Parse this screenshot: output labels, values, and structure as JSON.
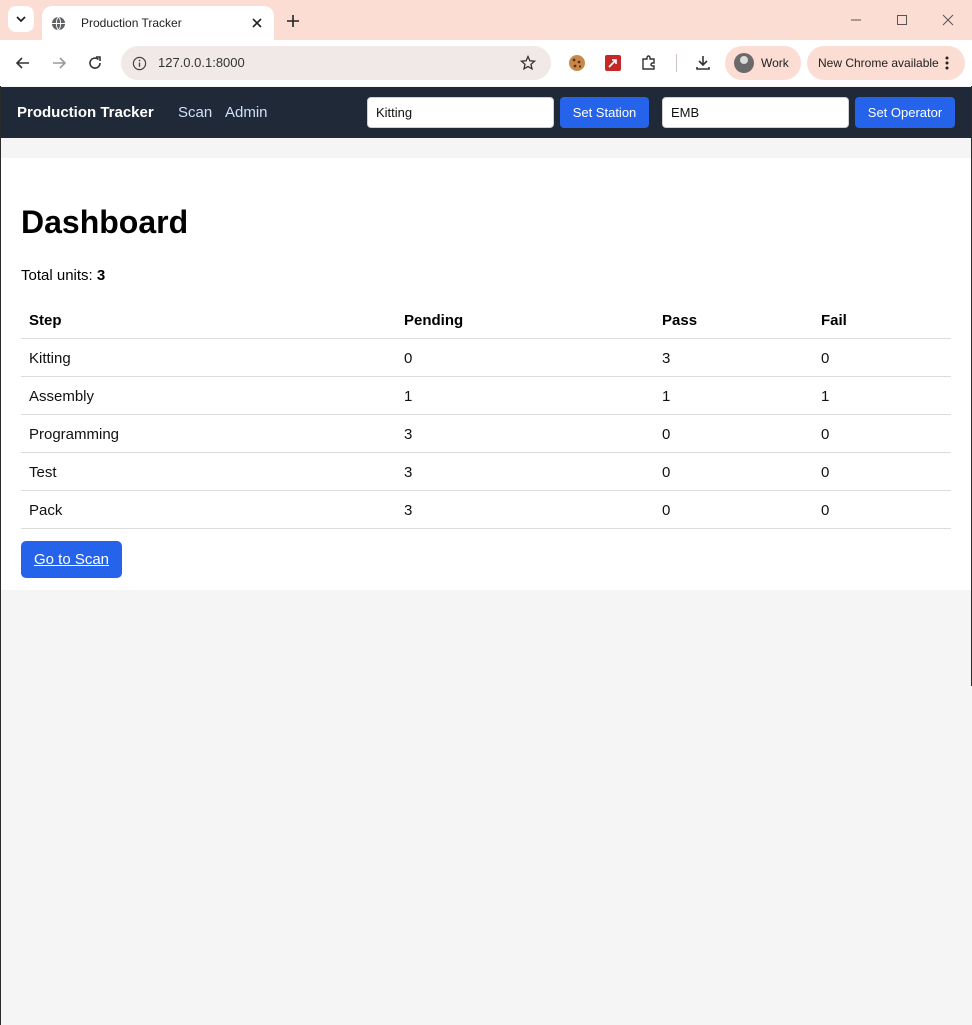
{
  "browser": {
    "tab_title": "Production Tracker",
    "url": "127.0.0.1:8000",
    "profile_name": "Work",
    "update_label": "New Chrome available"
  },
  "nav": {
    "brand": "Production Tracker",
    "links": [
      "Scan",
      "Admin"
    ],
    "station_value": "Kitting",
    "set_station_label": "Set Station",
    "operator_value": "EMB",
    "set_operator_label": "Set Operator"
  },
  "page": {
    "title": "Dashboard",
    "total_label": "Total units:",
    "total_value": "3",
    "cta_label": "Go to Scan"
  },
  "table": {
    "headers": [
      "Step",
      "Pending",
      "Pass",
      "Fail"
    ],
    "rows": [
      [
        "Kitting",
        "0",
        "3",
        "0"
      ],
      [
        "Assembly",
        "1",
        "1",
        "1"
      ],
      [
        "Programming",
        "3",
        "0",
        "0"
      ],
      [
        "Test",
        "3",
        "0",
        "0"
      ],
      [
        "Pack",
        "3",
        "0",
        "0"
      ]
    ]
  },
  "colors": {
    "navbar": "#1f2937",
    "accent": "#2563eb",
    "chrome_frame": "#fbddd3"
  }
}
